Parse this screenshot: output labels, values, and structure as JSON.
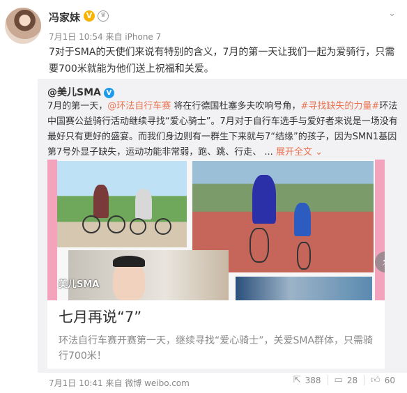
{
  "post": {
    "username": "冯家妹",
    "meta": "7月1日 10:54 来自 iPhone 7",
    "text": "7对于SMA的天使们来说有特别的含义，7月的第一天让我们一起为爱骑行，只需要700米就能为他们送上祝福和关爱。"
  },
  "repost": {
    "author": "@美儿SMA",
    "text_part1": "7月的第一天，",
    "link1": "@环法自行车赛",
    "text_part2": " 将在行德国杜塞多夫吹响号角，",
    "link2": "#寻找缺失的力量#",
    "text_part3": "环法中国赛公益骑行活动继续寻找“爱心骑士”。7月对于自行车选手与爱好者来说是一场没有最好只有更好的盛宴。而我们身边则有一群生下来就与7“结缘”的孩子，因为SMN1基因第7号外显子缺失，运动功能非常弱，跑、跳、行走、 ...",
    "expand_label": "展开全文",
    "watermark": "美儿SMA"
  },
  "card": {
    "title": "七月再说“7”",
    "description": "环法自行车赛开赛第一天，继续寻找“爱心骑士”，关爱SMA群体，只需骑行700米！"
  },
  "footer": {
    "meta": "7月1日 10:41 来自 微博 weibo.com",
    "repost_count": "388",
    "comment_count": "28",
    "like_count": "60"
  },
  "icons": {
    "verified": "verified-badge-icon",
    "crown": "member-crown-icon",
    "chevron": "chevron-down-icon",
    "share": "share-icon",
    "comment": "comment-icon",
    "like": "like-icon",
    "play": "flash-icon"
  },
  "colors": {
    "link": "#eb7350",
    "verified_gold": "#f6b400",
    "verified_blue": "#1e9be8",
    "repost_bg": "#f2f2f5"
  }
}
